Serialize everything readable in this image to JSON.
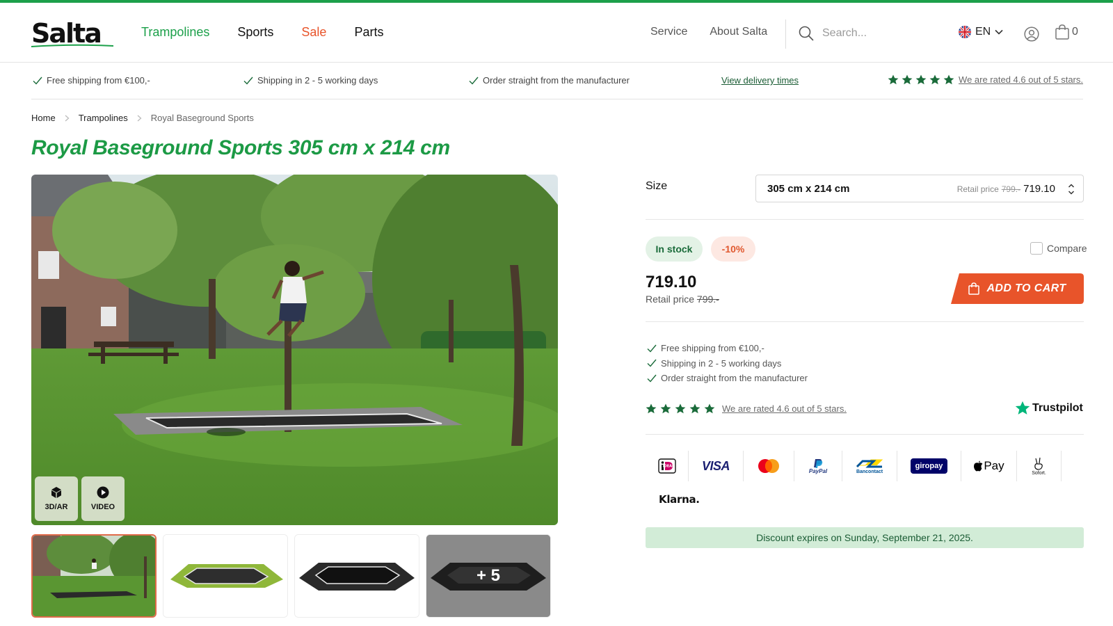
{
  "brand": {
    "logo_text": "Salta",
    "green": "#1ca04a",
    "orange": "#e8542a"
  },
  "nav": {
    "main": [
      {
        "label": "Trampolines",
        "color": "green"
      },
      {
        "label": "Sports",
        "color": "dark"
      },
      {
        "label": "Sale",
        "color": "red"
      },
      {
        "label": "Parts",
        "color": "dark"
      }
    ],
    "secondary": [
      "Service",
      "About Salta"
    ]
  },
  "search": {
    "placeholder": "Search..."
  },
  "language": {
    "code": "EN"
  },
  "cart": {
    "count": "0"
  },
  "usp_bar": {
    "items": [
      "Free shipping from €100,-",
      "Shipping in 2 - 5 working days",
      "Order straight from the manufacturer"
    ],
    "delivery_link": "View delivery times",
    "rating_text": "We are rated 4.6 out of 5 stars.",
    "stars": 5
  },
  "breadcrumb": [
    "Home",
    "Trampolines",
    "Royal Baseground Sports"
  ],
  "product": {
    "title": "Royal Baseground Sports 305 cm x 214 cm",
    "media_buttons": [
      "3D/AR",
      "VIDEO"
    ],
    "more_images_label": "+ 5",
    "size_label": "Size",
    "size_value": "305 cm x 214 cm",
    "size_retail_label": "Retail price",
    "size_retail_old": "799.-",
    "size_price": "719.10",
    "stock_badge": "In stock",
    "discount_badge": "-10%",
    "compare_label": "Compare",
    "price": "719.10",
    "retail_label": "Retail price",
    "retail_old": "799.-",
    "add_to_cart": "ADD TO CART",
    "shipping": [
      "Free shipping from €100,-",
      "Shipping in 2 - 5 working days",
      "Order straight from the manufacturer"
    ],
    "rating_text": "We are rated 4.6 out of 5 stars.",
    "trustpilot_label": "Trustpilot",
    "payment_methods": [
      "iDEAL",
      "VISA",
      "Mastercard",
      "PayPal",
      "Bancontact",
      "giropay",
      "Pay",
      "Sofort.",
      "Klarna."
    ],
    "discount_notice": "Discount expires on Sunday, September 21, 2025."
  }
}
